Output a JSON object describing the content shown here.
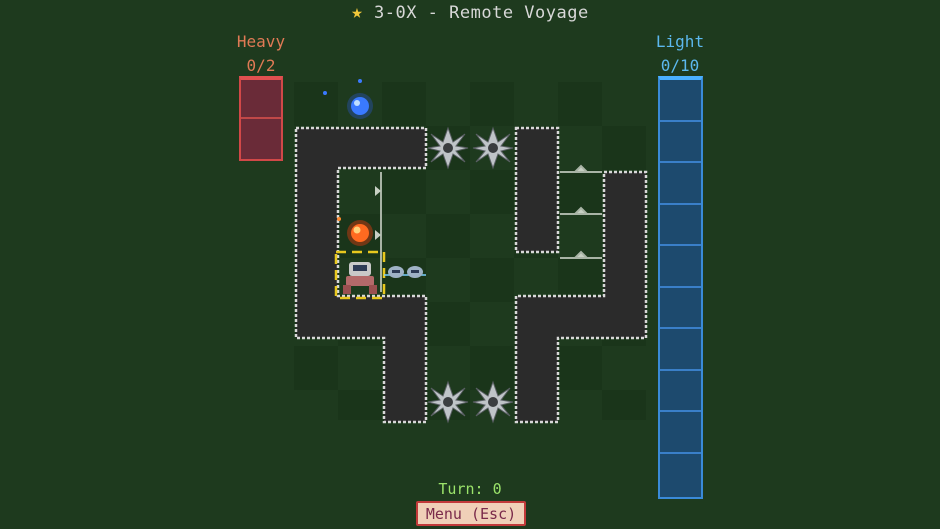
{
  "level": {
    "star_icon": "star-icon",
    "title": "3-0X - Remote Voyage"
  },
  "heavy_meter": {
    "label": "Heavy",
    "count": "0/2",
    "filled": 0,
    "capacity": 2,
    "color": "#d14848"
  },
  "light_meter": {
    "label": "Light",
    "count": "0/10",
    "filled": 0,
    "capacity": 10,
    "color": "#3a8ad8"
  },
  "hud": {
    "turn": "Turn: 0"
  },
  "menu": {
    "button_label": "Menu (Esc)"
  },
  "colors": {
    "background": "#1e3a1e",
    "wall": "#2b2b2b",
    "heavy": "#d14848",
    "light": "#3a8ad8",
    "selection": "#e8c81e",
    "turn_text": "#9be36a"
  },
  "entities": [
    "blue-orb-icon",
    "fire-orb-icon",
    "robot-player-icon",
    "drone-robot-icon",
    "spike-mine-icon",
    "arrow-gate-icon"
  ]
}
